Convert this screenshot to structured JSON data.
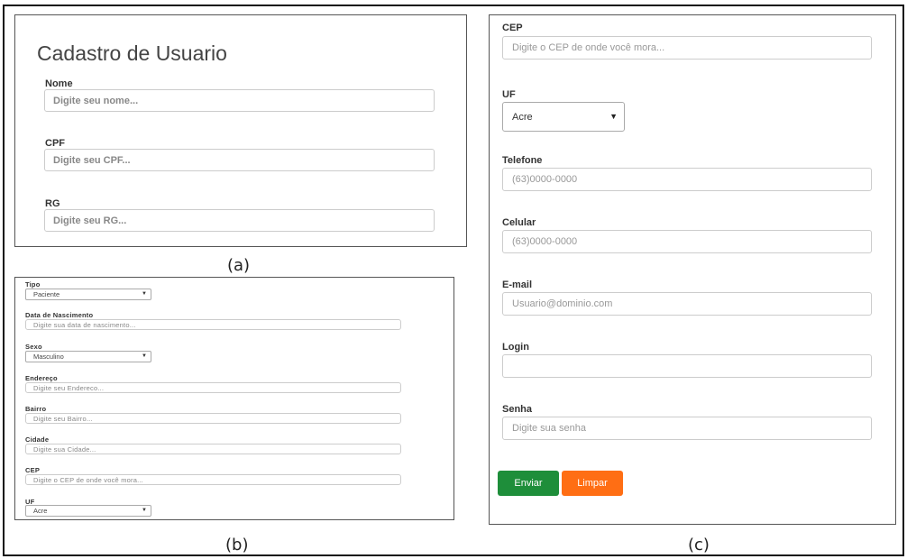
{
  "captions": {
    "a": "(a)",
    "b": "(b)",
    "c": "(c)"
  },
  "panel_a": {
    "title": "Cadastro de Usuario",
    "fields": [
      {
        "label": "Nome",
        "placeholder": "Digite seu nome..."
      },
      {
        "label": "CPF",
        "placeholder": "Digite seu CPF..."
      },
      {
        "label": "RG",
        "placeholder": "Digite seu RG..."
      }
    ]
  },
  "panel_b": {
    "tipo": {
      "label": "Tipo",
      "value": "Paciente"
    },
    "nascimento": {
      "label": "Data de Nascimento",
      "placeholder": "Digite sua data de nascimento..."
    },
    "sexo": {
      "label": "Sexo",
      "value": "Masculino"
    },
    "endereco": {
      "label": "Endereço",
      "placeholder": "Digite seu Endereco..."
    },
    "bairro": {
      "label": "Bairro",
      "placeholder": "Digite seu Bairro..."
    },
    "cidade": {
      "label": "Cidade",
      "placeholder": "Digite sua Cidade..."
    },
    "cep": {
      "label": "CEP",
      "placeholder": "Digite o CEP de onde você mora..."
    },
    "uf": {
      "label": "UF",
      "value": "Acre"
    }
  },
  "panel_c": {
    "cep": {
      "label": "CEP",
      "placeholder": "Digite o CEP de onde você mora..."
    },
    "uf": {
      "label": "UF",
      "value": "Acre"
    },
    "telefone": {
      "label": "Telefone",
      "placeholder": "(63)0000-0000"
    },
    "celular": {
      "label": "Celular",
      "placeholder": "(63)0000-0000"
    },
    "email": {
      "label": "E-mail",
      "placeholder": "Usuario@dominio.com"
    },
    "login": {
      "label": "Login",
      "value": ""
    },
    "senha": {
      "label": "Senha",
      "placeholder": "Digite sua senha"
    },
    "buttons": {
      "enviar": "Enviar",
      "limpar": "Limpar"
    }
  },
  "icons": {
    "dropdown": "▼"
  },
  "colors": {
    "enviar": "#1e8e3a",
    "limpar": "#ff6e14"
  }
}
